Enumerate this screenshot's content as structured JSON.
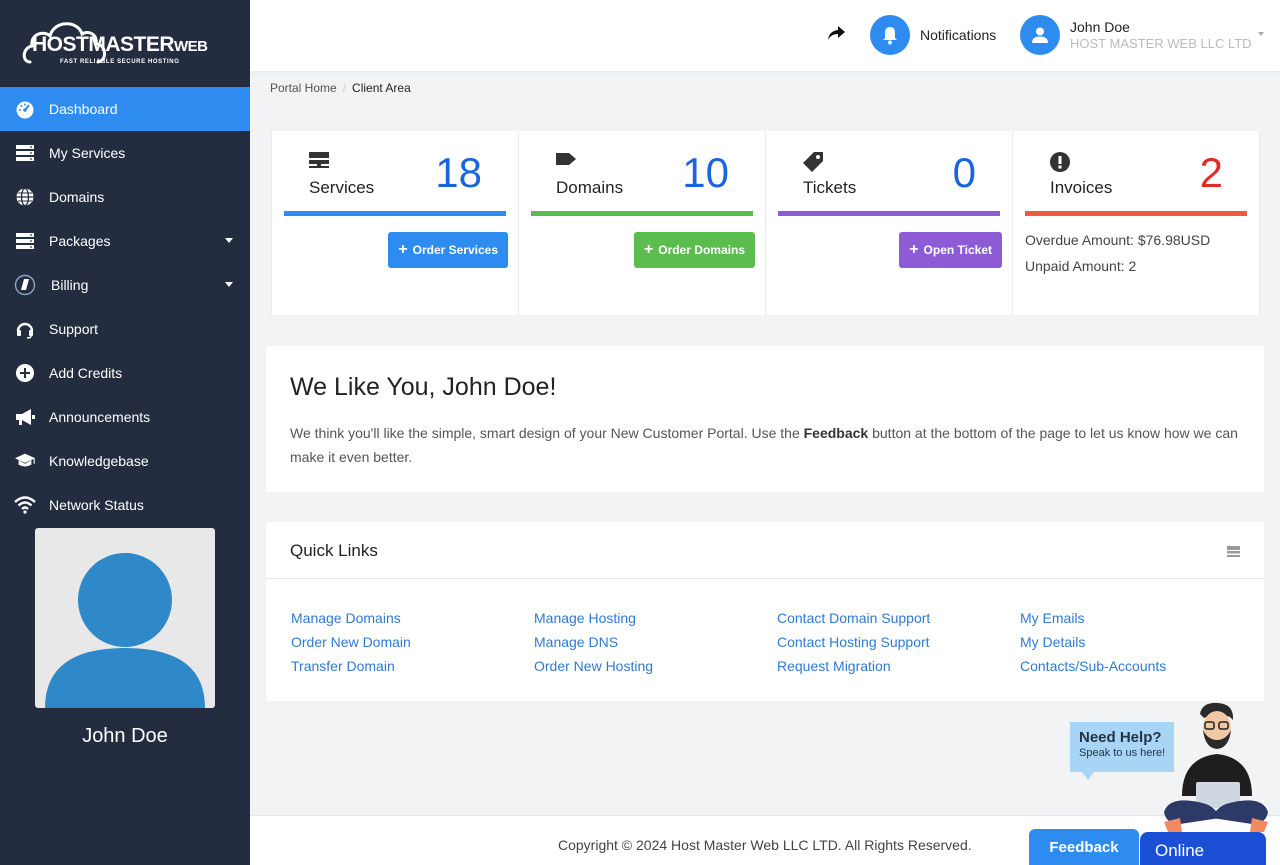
{
  "brand": {
    "main": "HOSTMASTER",
    "suffix": "WEB",
    "tagline": "FAST RELIABLE SECURE HOSTING"
  },
  "sidebar": {
    "items": [
      {
        "label": "Dashboard",
        "icon": "dashboard-icon",
        "active": true
      },
      {
        "label": "My Services",
        "icon": "server-icon"
      },
      {
        "label": "Domains",
        "icon": "globe-icon"
      },
      {
        "label": "Packages",
        "icon": "server-icon",
        "dropdown": true
      },
      {
        "label": "Billing",
        "icon": "billing-icon",
        "dropdown": true
      },
      {
        "label": "Support",
        "icon": "headset-icon"
      },
      {
        "label": "Add Credits",
        "icon": "plus-circle-icon"
      },
      {
        "label": "Announcements",
        "icon": "megaphone-icon"
      },
      {
        "label": "Knowledgebase",
        "icon": "graduation-cap-icon"
      },
      {
        "label": "Network Status",
        "icon": "wifi-icon"
      }
    ],
    "profile_name": "John Doe"
  },
  "header": {
    "notifications_label": "Notifications",
    "user_name": "John Doe",
    "user_company": "HOST MASTER WEB LLC LTD"
  },
  "breadcrumb": {
    "home": "Portal Home",
    "current": "Client Area"
  },
  "tiles": [
    {
      "label": "Services",
      "count": "18",
      "color": "#2e8cf0",
      "button": "Order Services",
      "icon": "server-icon"
    },
    {
      "label": "Domains",
      "count": "10",
      "color": "#5cbd4f",
      "button": "Order Domains",
      "icon": "tag-icon"
    },
    {
      "label": "Tickets",
      "count": "0",
      "color": "#8e5bd6",
      "button": "Open Ticket",
      "icon": "ticket-icon"
    },
    {
      "label": "Invoices",
      "count": "2",
      "color": "#ee5a3f",
      "count_color": "#e02b2b",
      "icon": "alert-circle-icon",
      "overdue": "Overdue Amount: $76.98USD",
      "unpaid": "Unpaid Amount: 2"
    }
  ],
  "welcome": {
    "title": "We Like You, John Doe!",
    "text_before": "We think you'll like the simple, smart design of your New Customer Portal. Use the ",
    "text_bold": "Feedback",
    "text_after": " button at the bottom of the page to let us know how we can make it even better."
  },
  "quick_links": {
    "title": "Quick Links",
    "columns": [
      [
        "Manage Domains",
        "Order New Domain",
        "Transfer Domain"
      ],
      [
        "Manage Hosting",
        "Manage DNS",
        "Order New Hosting"
      ],
      [
        "Contact Domain Support",
        "Contact Hosting Support",
        "Request Migration"
      ],
      [
        "My Emails",
        "My Details",
        "Contacts/Sub-Accounts"
      ]
    ]
  },
  "footer": {
    "copyright": "Copyright © 2024 Host Master Web LLC LTD. All Rights Reserved.",
    "feedback": "Feedback",
    "online": "Online"
  },
  "help_widget": {
    "title": "Need Help?",
    "subtitle": "Speak to us here!"
  }
}
